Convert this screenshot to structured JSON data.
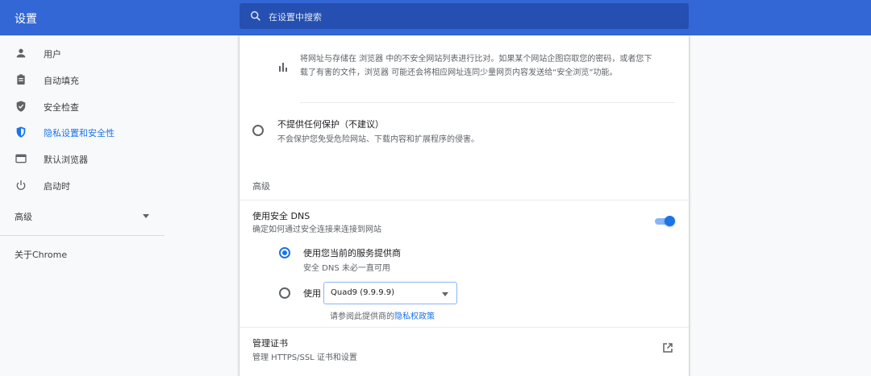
{
  "app": {
    "title": "设置"
  },
  "search": {
    "placeholder": "在设置中搜索",
    "icon": "search-icon"
  },
  "sidebar": {
    "items": [
      {
        "label": "用户",
        "icon": "person-icon"
      },
      {
        "label": "自动填充",
        "icon": "clipboard-icon"
      },
      {
        "label": "安全检查",
        "icon": "shield-check-icon"
      },
      {
        "label": "隐私设置和安全性",
        "icon": "privacy-shield-icon",
        "active": true
      },
      {
        "label": "默认浏览器",
        "icon": "browser-window-icon"
      },
      {
        "label": "启动时",
        "icon": "power-icon"
      }
    ],
    "advanced_label": "高级",
    "about_label": "关于Chrome"
  },
  "main": {
    "info_text_line1": "将网址与存储在 浏览器 中的不安全网站列表进行比对。如果某个网站企图窃取您的密码，或者您下",
    "info_text_line2": "载了有害的文件，浏览器 可能还会将相应网址连同少量网页内容发送给“安全浏览”功能。",
    "no_protection": {
      "title": "不提供任何保护（不建议）",
      "desc": "不会保护您免受危险网站、下载内容和扩展程序的侵害。"
    },
    "advanced_heading": "高级",
    "secure_dns": {
      "title": "使用安全 DNS",
      "desc": "确定如何通过安全连接来连接到网站",
      "enabled": true,
      "option_current": {
        "title": "使用您当前的服务提供商",
        "desc": "安全 DNS 未必一直可用"
      },
      "option_custom_label": "使用",
      "provider_selected": "Quad9 (9.9.9.9)",
      "policy_prefix": "请参阅此提供商的",
      "policy_link": "隐私权政策"
    },
    "certificates": {
      "title": "管理证书",
      "desc": "管理 HTTPS/SSL 证书和设置"
    }
  },
  "colors": {
    "header": "#3367d6",
    "accent": "#1a73e8"
  }
}
